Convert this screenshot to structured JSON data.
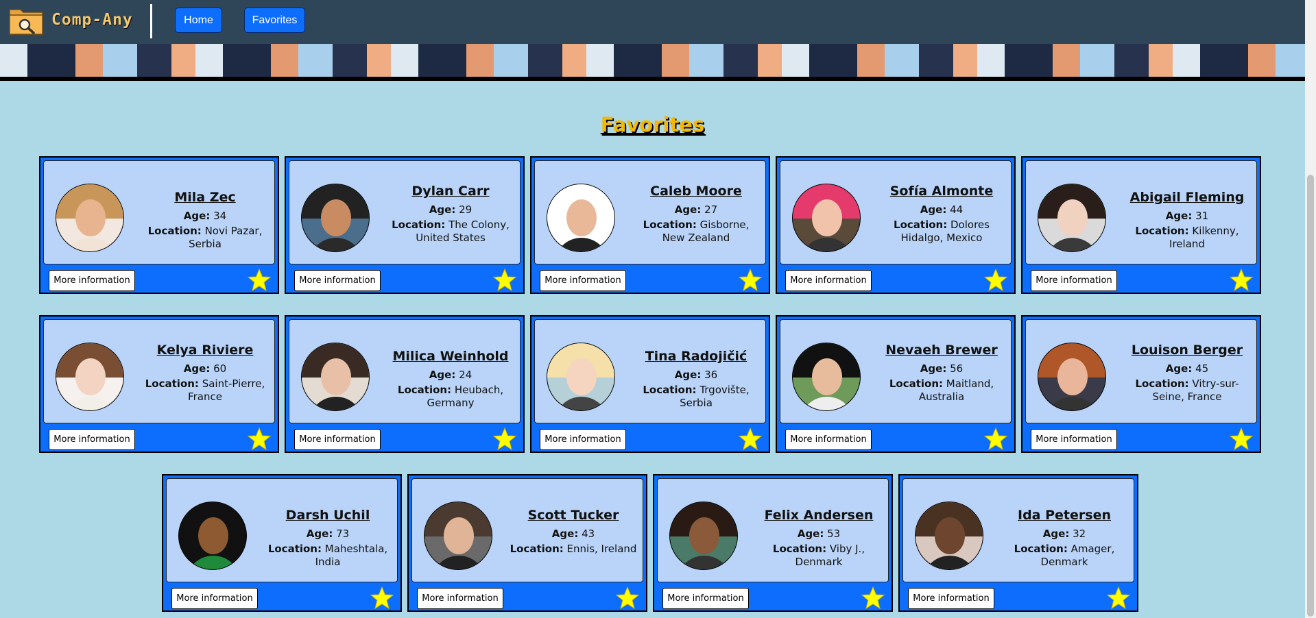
{
  "nav": {
    "brand": "Comp-Any",
    "home_label": "Home",
    "favorites_label": "Favorites"
  },
  "page": {
    "title": "Favorites"
  },
  "labels": {
    "age": "Age:",
    "location": "Location:",
    "more_info": "More information"
  },
  "colors": {
    "card": "#0d6efd",
    "inner": "#b9d4f8",
    "background": "#add8e6",
    "nav": "#2f4558",
    "star": "#ffff00",
    "title": "#f5b800"
  },
  "favorites": [
    {
      "name": "Mila Zec",
      "age": "34",
      "location": "Novi Pazar, Serbia"
    },
    {
      "name": "Dylan Carr",
      "age": "29",
      "location": "The Colony, United States"
    },
    {
      "name": "Caleb Moore",
      "age": "27",
      "location": "Gisborne, New Zealand"
    },
    {
      "name": "Sofía Almonte",
      "age": "44",
      "location": "Dolores Hidalgo, Mexico"
    },
    {
      "name": "Abigail Fleming",
      "age": "31",
      "location": "Kilkenny, Ireland"
    },
    {
      "name": "Kelya Riviere",
      "age": "60",
      "location": "Saint-Pierre, France"
    },
    {
      "name": "Milica Weinhold",
      "age": "24",
      "location": "Heubach, Germany"
    },
    {
      "name": "Tina Radojičić",
      "age": "36",
      "location": "Trgovište, Serbia"
    },
    {
      "name": "Nevaeh Brewer",
      "age": "56",
      "location": "Maitland, Australia"
    },
    {
      "name": "Louison Berger",
      "age": "45",
      "location": "Vitry-sur-Seine, France"
    },
    {
      "name": "Darsh Uchil",
      "age": "73",
      "location": "Maheshtala, India"
    },
    {
      "name": "Scott Tucker",
      "age": "43",
      "location": "Ennis, Ireland"
    },
    {
      "name": "Felix Andersen",
      "age": "53",
      "location": "Viby J., Denmark"
    },
    {
      "name": "Ida Petersen",
      "age": "32",
      "location": "Amager, Denmark"
    }
  ]
}
